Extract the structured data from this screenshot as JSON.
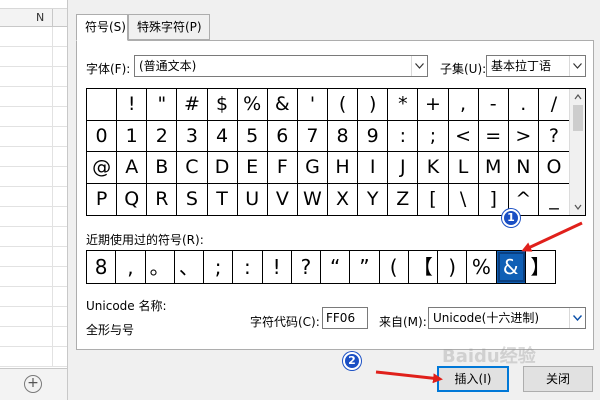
{
  "sheet": {
    "column_header": "N",
    "add_sheet_icon": "plus-circle-icon"
  },
  "tabs": [
    {
      "label": "符号(S)",
      "active": true
    },
    {
      "label": "特殊字符(P)",
      "active": false
    }
  ],
  "font": {
    "label": "字体(F):",
    "value": "(普通文本)"
  },
  "subset": {
    "label": "子集(U):",
    "value": "基本拉丁语"
  },
  "symbol_grid": {
    "rows": [
      [
        "",
        "!",
        "\"",
        "#",
        "$",
        "%",
        "&",
        "'",
        "(",
        ")",
        "*",
        "+",
        ",",
        "-",
        ".",
        "/"
      ],
      [
        "0",
        "1",
        "2",
        "3",
        "4",
        "5",
        "6",
        "7",
        "8",
        "9",
        ":",
        ";",
        "<",
        "=",
        ">",
        "?"
      ],
      [
        "@",
        "A",
        "B",
        "C",
        "D",
        "E",
        "F",
        "G",
        "H",
        "I",
        "J",
        "K",
        "L",
        "M",
        "N",
        "O"
      ],
      [
        "P",
        "Q",
        "R",
        "S",
        "T",
        "U",
        "V",
        "W",
        "X",
        "Y",
        "Z",
        "[",
        "\\",
        "]",
        "^",
        "_"
      ]
    ]
  },
  "recent": {
    "label": "近期使用过的符号(R):",
    "symbols": [
      "8",
      ",",
      "。",
      "、",
      ";",
      ":",
      "!",
      "?",
      "“",
      "”",
      "(",
      "【",
      ")",
      "%",
      "&",
      "】"
    ],
    "selected_index": 14
  },
  "unicode_name": {
    "label": "Unicode 名称:",
    "value": "全形与号"
  },
  "char_code": {
    "label": "字符代码(C):",
    "value": "FF06"
  },
  "from": {
    "label": "来自(M):",
    "value": "Unicode(十六进制)"
  },
  "buttons": {
    "insert": "插入(I)",
    "close": "关闭"
  },
  "annotations": [
    "1",
    "2"
  ],
  "watermark": "Baidu经验",
  "colors": {
    "selection": "#0f5fb5",
    "annotation": "#1a4fc4",
    "arrow": "#e0201b",
    "default_button_border": "#0078d7"
  }
}
